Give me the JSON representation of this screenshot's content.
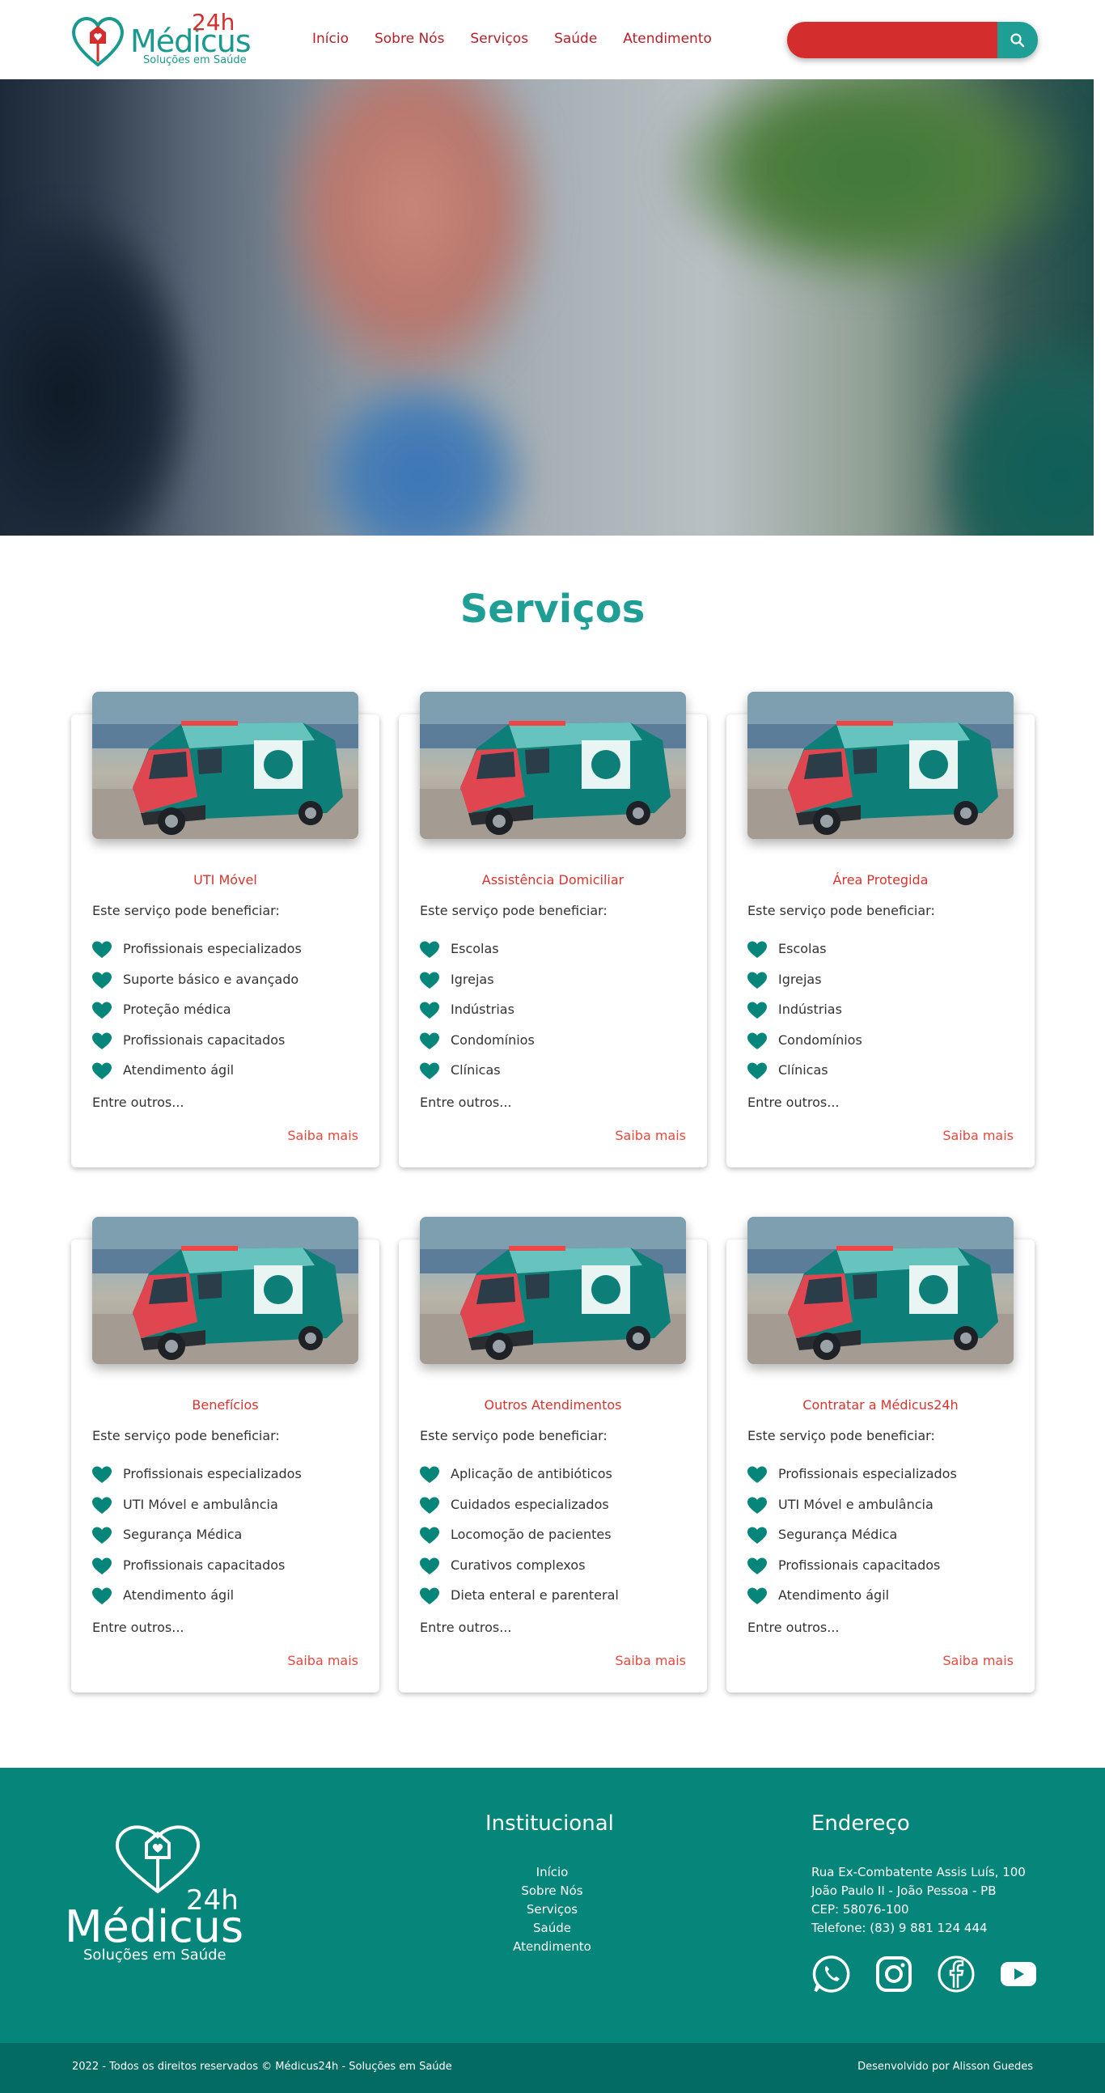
{
  "header": {
    "logo": {
      "word": "Médicus",
      "superscript": "24h",
      "tagline": "Soluções em Saúde"
    },
    "nav": [
      "Início",
      "Sobre Nós",
      "Serviços",
      "Saúde",
      "Atendimento"
    ],
    "search": {
      "placeholder": ""
    }
  },
  "colors": {
    "brand_teal": "#1f9e96",
    "brand_red": "#d42d2d",
    "footer": "#06857a"
  },
  "services": {
    "title": "Serviços",
    "intro": "Este serviço pode beneficiar:",
    "more": "Entre outros...",
    "link": "Saiba mais",
    "cards": [
      {
        "title": "UTI Móvel",
        "items": [
          "Profissionais especializados",
          "Suporte básico e avançado",
          "Proteção médica",
          "Profissionais capacitados",
          "Atendimento ágil"
        ]
      },
      {
        "title": "Assistência Domiciliar",
        "items": [
          "Escolas",
          "Igrejas",
          "Indústrias",
          "Condomínios",
          "Clínicas"
        ]
      },
      {
        "title": "Área Protegida",
        "items": [
          "Escolas",
          "Igrejas",
          "Indústrias",
          "Condomínios",
          "Clínicas"
        ]
      },
      {
        "title": "Benefícios",
        "items": [
          "Profissionais especializados",
          "UTI Móvel e ambulância",
          "Segurança Médica",
          "Profissionais capacitados",
          "Atendimento ágil"
        ]
      },
      {
        "title": "Outros Atendimentos",
        "items": [
          "Aplicação de antibióticos",
          "Cuidados especializados",
          "Locomoção de pacientes",
          "Curativos complexos",
          "Dieta enteral e parenteral"
        ]
      },
      {
        "title": "Contratar a Médicus24h",
        "items": [
          "Profissionais especializados",
          "UTI Móvel e ambulância",
          "Segurança Médica",
          "Profissionais capacitados",
          "Atendimento ágil"
        ]
      }
    ]
  },
  "footer": {
    "logo": {
      "word": "Médicus",
      "superscript": "24h",
      "tagline": "Soluções em Saúde"
    },
    "institutional": {
      "title": "Institucional",
      "links": [
        "Início",
        "Sobre Nós",
        "Serviços",
        "Saúde",
        "Atendimento"
      ]
    },
    "address": {
      "title": "Endereço",
      "lines": [
        "Rua Ex-Combatente Assis Luís, 100",
        "João Paulo II - João Pessoa - PB",
        "CEP: 58076-100",
        "Telefone: (83) 9 881 124 444"
      ]
    },
    "socials": [
      "whatsapp-icon",
      "instagram-icon",
      "facebook-icon",
      "youtube-icon"
    ],
    "copyright": "2022 - Todos os direitos reservados © Médicus24h - Soluções em Saúde",
    "developer": "Desenvolvido por Alisson Guedes"
  }
}
